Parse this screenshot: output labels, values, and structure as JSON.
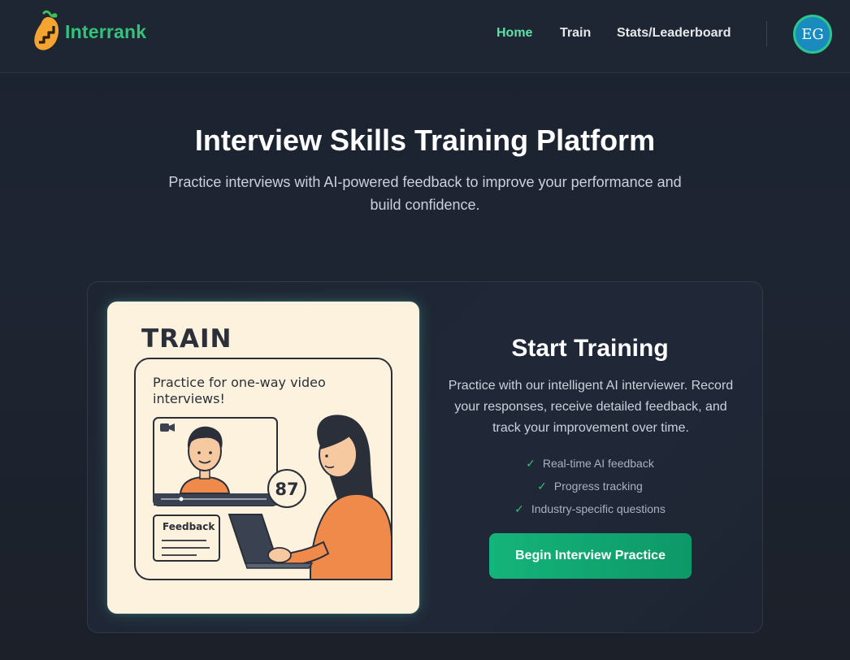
{
  "brand": {
    "name": "Interrank",
    "logo_color": "#34c27a"
  },
  "nav": {
    "items": [
      {
        "label": "Home",
        "active": true
      },
      {
        "label": "Train",
        "active": false
      },
      {
        "label": "Stats/Leaderboard",
        "active": false
      }
    ],
    "active_color": "#5ee0a6"
  },
  "user": {
    "initials": "EG",
    "avatar_color": "#1a8bbf",
    "ring_color": "#2dc58b"
  },
  "hero": {
    "title": "Interview Skills Training Platform",
    "subtitle": "Practice interviews with AI-powered feedback to improve your performance and build confidence."
  },
  "training_card": {
    "illustration": {
      "title": "TRAIN",
      "caption": "Practice for one-way video interviews!",
      "score": "87",
      "feedback_label": "Feedback",
      "icons": [
        "video-camera-icon",
        "interviewer-avatar",
        "woman-with-laptop"
      ]
    },
    "title": "Start Training",
    "description": "Practice with our intelligent AI interviewer. Record your responses, receive detailed feedback, and track your improvement over time.",
    "features": [
      {
        "icon": "check-icon",
        "label": "Real-time AI feedback"
      },
      {
        "icon": "check-icon",
        "label": "Progress tracking"
      },
      {
        "icon": "check-icon",
        "label": "Industry-specific questions"
      }
    ],
    "cta_label": "Begin Interview Practice",
    "accent_color": "#14b47a"
  }
}
